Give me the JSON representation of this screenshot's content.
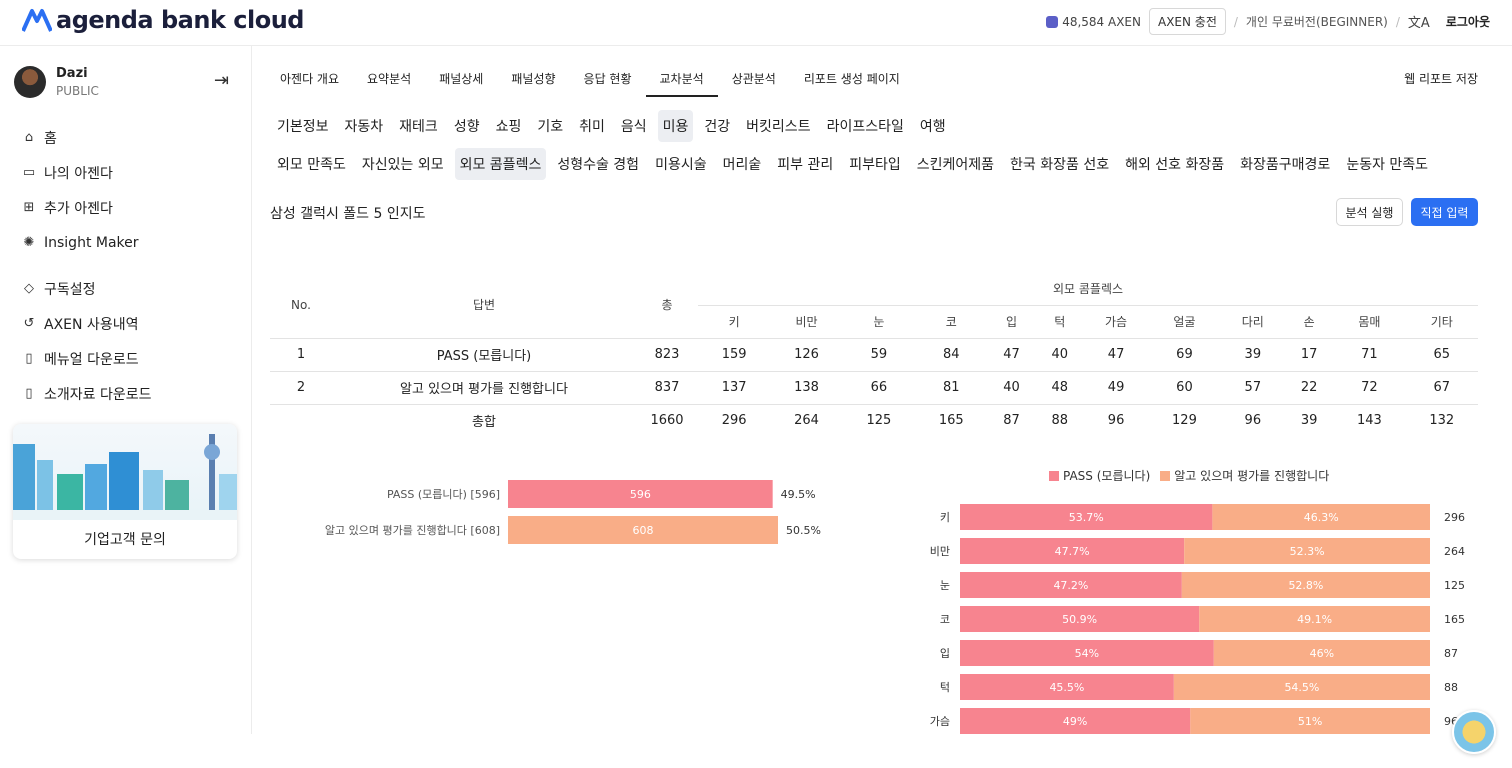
{
  "brand": {
    "name_part1": "agenda",
    "name_part2": " bank cloud"
  },
  "topbar": {
    "axen_balance": "48,584 AXEN",
    "charge_label": "AXEN 충전",
    "plan": "개인 무료버전(BEGINNER)",
    "logout_label": "로그아웃",
    "icons": [
      "axen-coin-icon",
      "translate-icon"
    ]
  },
  "user": {
    "name": "Dazi",
    "role": "PUBLIC"
  },
  "sidebar": {
    "items": [
      {
        "label": "홈",
        "icon": "home-icon"
      },
      {
        "label": "나의 아젠다",
        "icon": "folder-icon"
      },
      {
        "label": "추가 아젠다",
        "icon": "folder-plus-icon"
      },
      {
        "label": "Insight Maker",
        "icon": "insight-icon"
      },
      {
        "label": "구독설정",
        "icon": "diamond-icon"
      },
      {
        "label": "AXEN 사용내역",
        "icon": "history-icon"
      },
      {
        "label": "메뉴얼 다운로드",
        "icon": "book-icon"
      },
      {
        "label": "소개자료 다운로드",
        "icon": "book-open-icon"
      }
    ],
    "promo_label": "기업고객 문의"
  },
  "main_tabs": [
    "아젠다 개요",
    "요약분석",
    "패널상세",
    "패널성향",
    "응답 현황",
    "교차분석",
    "상관분석",
    "리포트 생성 페이지"
  ],
  "active_main_tab": "교차분석",
  "save_report_label": "웹 리포트 저장",
  "category_chips": [
    "기본정보",
    "자동차",
    "재테크",
    "성향",
    "쇼핑",
    "기호",
    "취미",
    "음식",
    "미용",
    "건강",
    "버킷리스트",
    "라이프스타일",
    "여행"
  ],
  "active_category": "미용",
  "sub_chips": [
    "외모 만족도",
    "자신있는 외모",
    "외모 콤플렉스",
    "성형수술 경험",
    "미용시술",
    "머리숱",
    "피부 관리",
    "피부타입",
    "스킨케어제품",
    "한국 화장품 선호",
    "해외 선호 화장품",
    "화장품구매경로",
    "눈동자 만족도"
  ],
  "active_sub": "외모 콤플렉스",
  "question_title": "삼성 갤럭시 폴드 5 인지도",
  "buttons": {
    "run": "분석 실행",
    "direct": "직접 입력"
  },
  "table": {
    "col_no": "No.",
    "col_answer": "답변",
    "col_total": "총",
    "group_header": "외모 콤플렉스",
    "columns": [
      "키",
      "비만",
      "눈",
      "코",
      "입",
      "턱",
      "가슴",
      "얼굴",
      "다리",
      "손",
      "몸매",
      "기타"
    ],
    "rows": [
      {
        "no": "1",
        "answer": "PASS (모릅니다)",
        "total": "823",
        "values": [
          "159",
          "126",
          "59",
          "84",
          "47",
          "40",
          "47",
          "69",
          "39",
          "17",
          "71",
          "65"
        ]
      },
      {
        "no": "2",
        "answer": "알고 있으며 평가를 진행합니다",
        "total": "837",
        "values": [
          "137",
          "138",
          "66",
          "81",
          "40",
          "48",
          "49",
          "60",
          "57",
          "22",
          "72",
          "67"
        ]
      }
    ],
    "total_row": {
      "label": "총합",
      "total": "1660",
      "values": [
        "296",
        "264",
        "125",
        "165",
        "87",
        "88",
        "96",
        "129",
        "96",
        "39",
        "143",
        "132"
      ]
    }
  },
  "chart_data": [
    {
      "type": "bar",
      "orientation": "horizontal",
      "categories": [
        "PASS (모릅니다) [596]",
        "알고 있으며 평가를 진행합니다 [608]"
      ],
      "values": [
        596,
        608
      ],
      "percent_labels": [
        "49.5%",
        "50.5%"
      ],
      "colors": [
        "#f7848f",
        "#f9ad87"
      ]
    },
    {
      "type": "bar",
      "orientation": "horizontal",
      "stacked": true,
      "categories": [
        "키",
        "비만",
        "눈",
        "코",
        "입",
        "턱",
        "가슴"
      ],
      "series": [
        {
          "name": "PASS (모릅니다)",
          "values": [
            53.7,
            47.7,
            47.2,
            50.9,
            54,
            45.5,
            49
          ],
          "labels": [
            "53.7%",
            "47.7%",
            "47.2%",
            "50.9%",
            "54%",
            "45.5%",
            "49%"
          ],
          "color": "#f7848f"
        },
        {
          "name": "알고 있으며 평가를 진행합니다",
          "values": [
            46.3,
            52.3,
            52.8,
            49.1,
            46,
            54.5,
            51
          ],
          "labels": [
            "46.3%",
            "52.3%",
            "52.8%",
            "49.1%",
            "46%",
            "54.5%",
            "51%"
          ],
          "color": "#f9ad87"
        }
      ],
      "totals": [
        "296",
        "264",
        "125",
        "165",
        "87",
        "88",
        "96"
      ],
      "legend": "top"
    }
  ]
}
